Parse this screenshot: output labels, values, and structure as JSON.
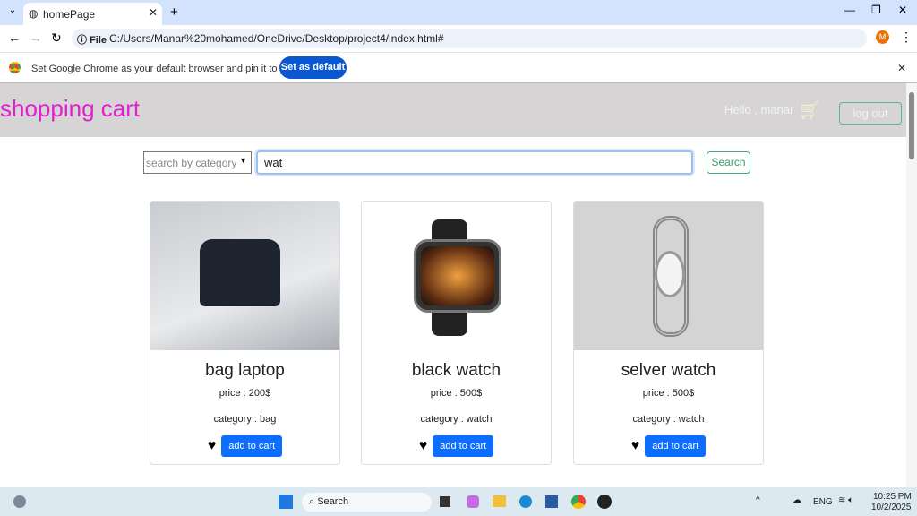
{
  "browser": {
    "tab_title": "homePage",
    "url_chip": "File",
    "url": "C:/Users/Manar%20mohamed/OneDrive/Desktop/project4/index.html#",
    "profile": "M",
    "infobar_text": "Set Google Chrome as your default browser and pin it to your taskbar",
    "infobar_button": "Set as default"
  },
  "header": {
    "title": "shopping cart",
    "greeting": "Hello , manar",
    "logout": "log out"
  },
  "search": {
    "category_placeholder": "search by category",
    "query": "wat",
    "button": "Search"
  },
  "products": [
    {
      "name": "bag laptop",
      "price": "price : 200$",
      "category": "category : bag",
      "button": "add to cart"
    },
    {
      "name": "black watch",
      "price": "price : 500$",
      "category": "category : watch",
      "button": "add to cart"
    },
    {
      "name": "selver watch",
      "price": "price : 500$",
      "category": "category : watch",
      "button": "add to cart"
    }
  ],
  "taskbar": {
    "search": "Search",
    "lang": "ENG",
    "time": "10:25 PM",
    "date": "10/2/2025"
  }
}
